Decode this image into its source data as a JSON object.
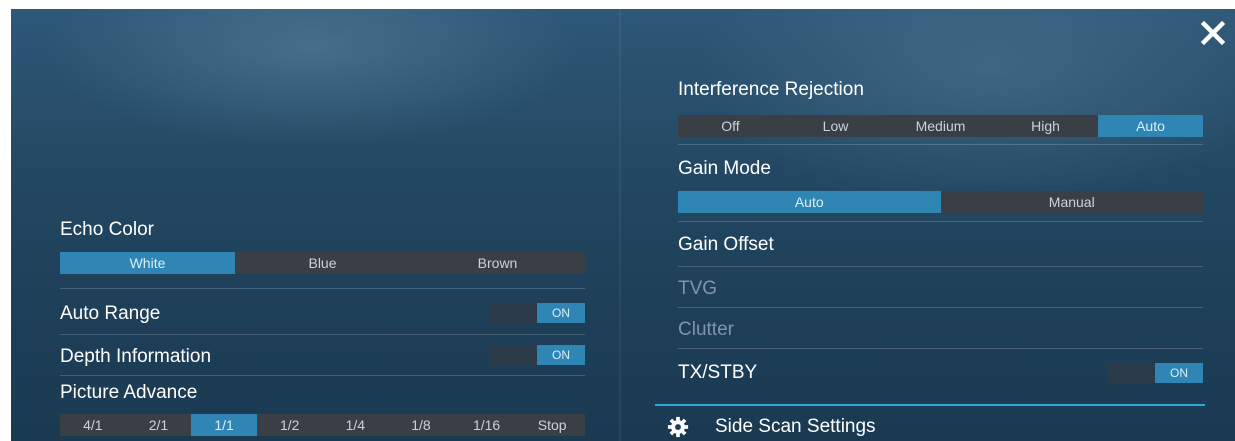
{
  "left": {
    "echo_color": {
      "label": "Echo Color",
      "options": [
        "White",
        "Blue",
        "Brown"
      ],
      "selected": "White"
    },
    "auto_range": {
      "label": "Auto Range",
      "state": "ON"
    },
    "depth_information": {
      "label": "Depth Information",
      "state": "ON"
    },
    "picture_advance": {
      "label": "Picture Advance",
      "options": [
        "4/1",
        "2/1",
        "1/1",
        "1/2",
        "1/4",
        "1/8",
        "1/16",
        "Stop"
      ],
      "selected": "1/1"
    }
  },
  "right": {
    "interference_rejection": {
      "label": "Interference Rejection",
      "options": [
        "Off",
        "Low",
        "Medium",
        "High",
        "Auto"
      ],
      "selected": "Auto"
    },
    "gain_mode": {
      "label": "Gain Mode",
      "options": [
        "Auto",
        "Manual"
      ],
      "selected": "Auto"
    },
    "gain_offset": {
      "label": "Gain Offset"
    },
    "tvg": {
      "label": "TVG"
    },
    "clutter": {
      "label": "Clutter"
    },
    "tx_stby": {
      "label": "TX/STBY",
      "state": "ON"
    }
  },
  "footer": {
    "label": "Side Scan Settings",
    "icon": "gear-icon"
  },
  "close": {
    "icon": "close-icon"
  },
  "colors": {
    "accent": "#2f86b4",
    "segment_bg": "#3a3f45",
    "footer_line": "#2fa8d8",
    "background": "#1e3f58",
    "disabled_text": "#7f95a8"
  }
}
